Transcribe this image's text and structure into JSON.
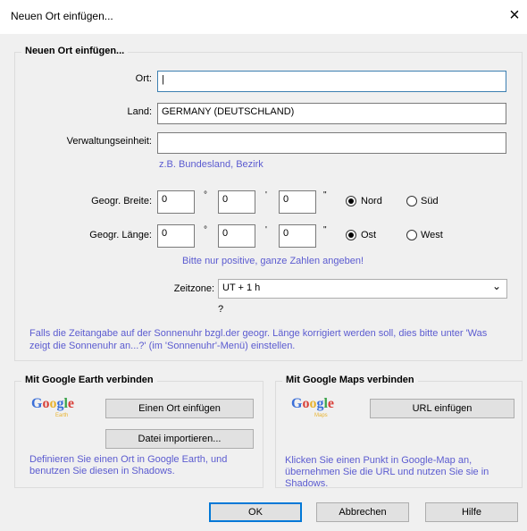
{
  "window": {
    "title": "Neuen Ort einfügen...",
    "close_glyph": "×"
  },
  "main_group": {
    "title": "Neuen Ort einfügen...",
    "ort": {
      "label": "Ort:",
      "value": "|"
    },
    "land": {
      "label": "Land:",
      "value": "GERMANY (DEUTSCHLAND)"
    },
    "verwaltung": {
      "label": "Verwaltungseinheit:",
      "value": "",
      "hint": "z.B. Bundesland, Bezirk"
    },
    "breite": {
      "label": "Geogr. Breite:",
      "deg": "0",
      "min": "0",
      "sec": "0",
      "deg_sym": "°",
      "min_sym": "'",
      "sec_sym": "\"",
      "opt1": "Nord",
      "opt2": "Süd",
      "selected": "Nord"
    },
    "laenge": {
      "label": "Geogr. Länge:",
      "deg": "0",
      "min": "0",
      "sec": "0",
      "deg_sym": "°",
      "min_sym": "'",
      "sec_sym": "\"",
      "opt1": "Ost",
      "opt2": "West",
      "selected": "Ost"
    },
    "positive_hint": "Bitte nur positive, ganze Zahlen angeben!",
    "zeitzone": {
      "label": "Zeitzone:",
      "value": "UT + 1 h",
      "chevron": "⌄",
      "question": "?"
    },
    "note": "Falls die Zeitangabe auf der Sonnenuhr bzgl.der geogr. Länge korrigiert werden soll, dies bitte unter 'Was zeigt die Sonnenuhr an...?' (im 'Sonnenuhr'-Menü) einstellen."
  },
  "earth_group": {
    "title": "Mit Google Earth verbinden",
    "logo_text": "Google",
    "logo_sub": "Earth",
    "btn_insert": "Einen Ort einfügen",
    "btn_import": "Datei importieren...",
    "description": "Definieren Sie einen Ort in Google Earth, und benutzen Sie diesen in Shadows."
  },
  "maps_group": {
    "title": "Mit Google Maps verbinden",
    "logo_text": "Google",
    "logo_sub": "Maps",
    "btn_url": "URL einfügen",
    "description": "Klicken Sie einen Punkt in Google-Map an, übernehmen Sie die URL und nutzen Sie sie in Shadows."
  },
  "footer": {
    "ok": "OK",
    "cancel": "Abbrechen",
    "help": "Hilfe"
  },
  "colors": {
    "hint": "#5b5bd0",
    "focus": "#3c7fb1",
    "default_button": "#0078d7"
  }
}
